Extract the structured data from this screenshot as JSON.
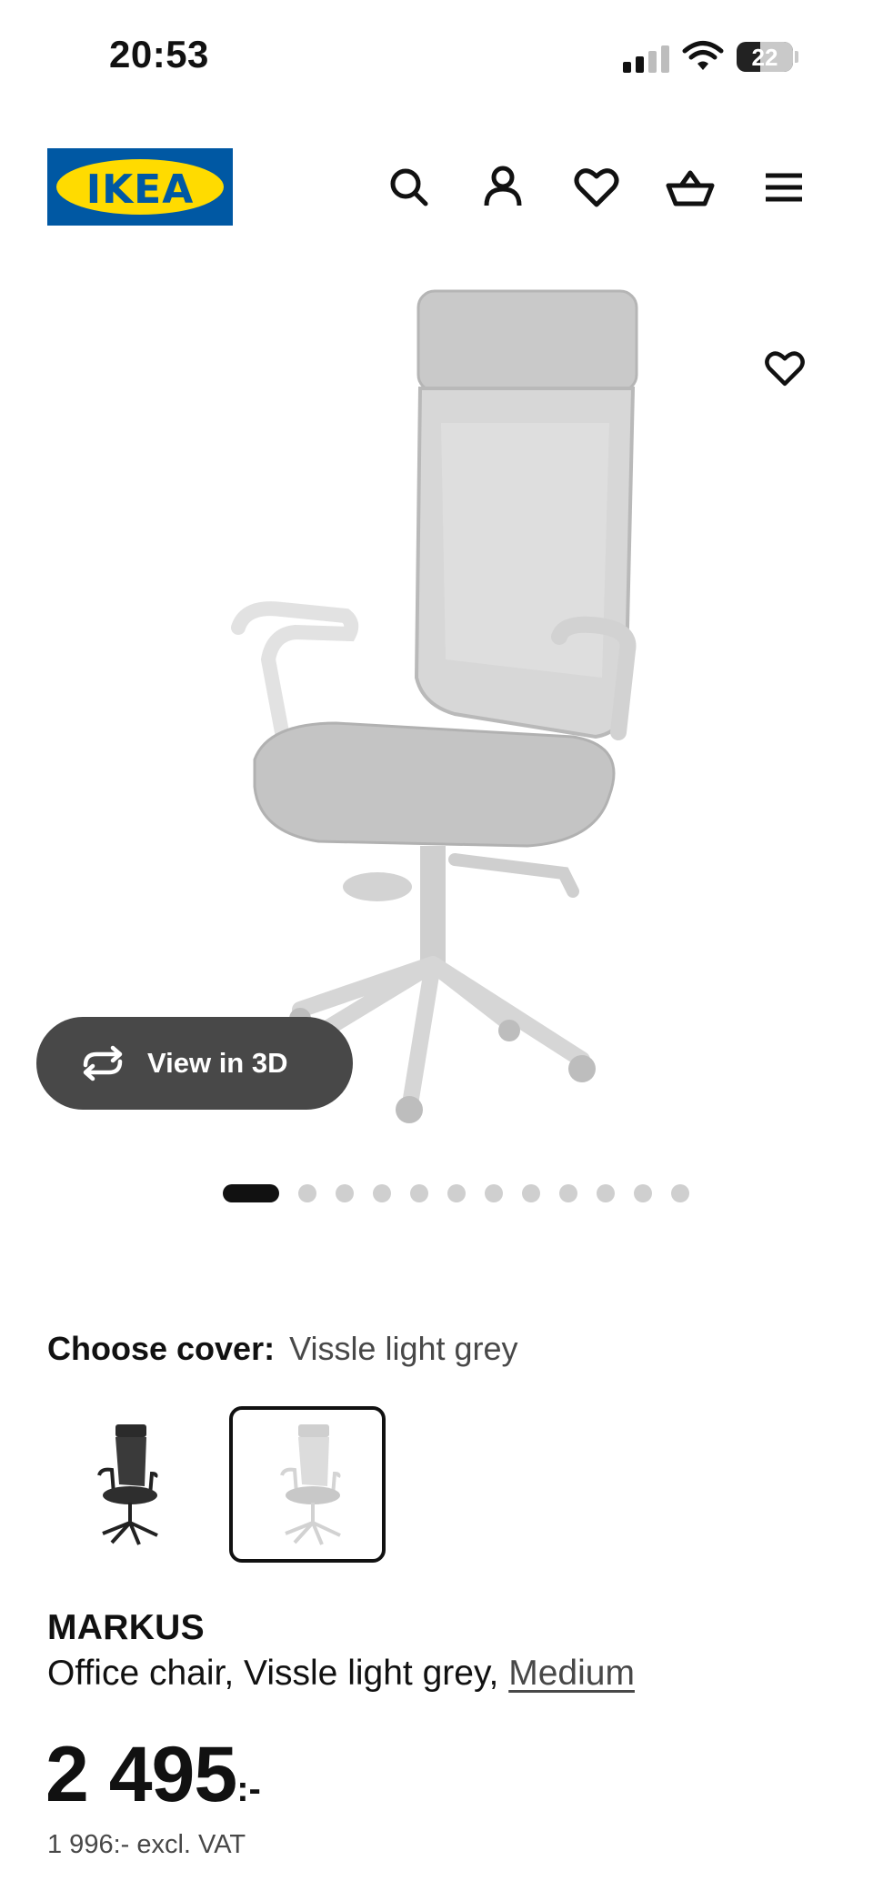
{
  "status_bar": {
    "time": "20:53",
    "battery": "22",
    "icons": [
      "cellular-signal-icon",
      "wifi-icon",
      "battery-icon"
    ]
  },
  "header": {
    "logo_text": "IKEA",
    "brand_colors": {
      "blue": "#0058a3",
      "yellow": "#ffdb00"
    },
    "nav_icons": [
      "search-icon",
      "account-icon",
      "heart-icon",
      "basket-icon",
      "menu-icon"
    ]
  },
  "gallery": {
    "view3d_label": "View in 3D",
    "image_count": 12,
    "active_index": 0
  },
  "cover": {
    "label": "Choose cover:",
    "selected": "Vissle light grey",
    "options": [
      "dark-grey-chair",
      "light-grey-chair"
    ],
    "selected_index": 1
  },
  "product": {
    "name": "MARKUS",
    "description": "Office chair, Vissle light grey, ",
    "size_link": "Medium",
    "price_int": "2 495",
    "price_currency": ":-",
    "price_ex_vat": "1 996:- excl. VAT"
  }
}
